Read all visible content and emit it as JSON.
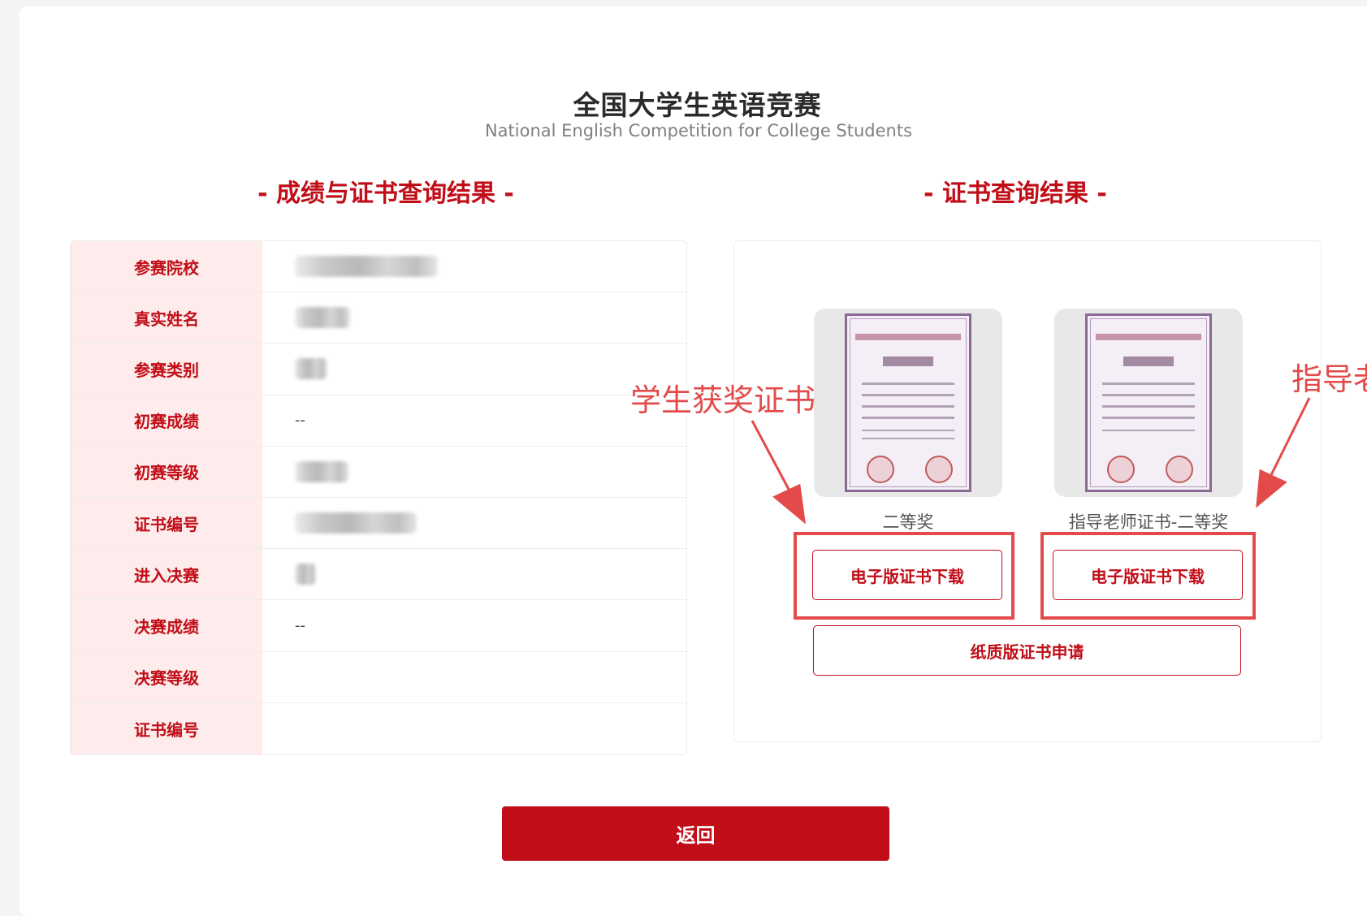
{
  "header": {
    "title": "全国大学生英语竞赛",
    "subtitle": "National English Competition for College Students"
  },
  "sections": {
    "left_title": "- 成绩与证书查询结果 -",
    "right_title": "- 证书查询结果 -"
  },
  "score_table": {
    "rows": [
      {
        "label": "参赛院校",
        "value": ""
      },
      {
        "label": "真实姓名",
        "value": ""
      },
      {
        "label": "参赛类别",
        "value": ""
      },
      {
        "label": "初赛成绩",
        "value": "--"
      },
      {
        "label": "初赛等级",
        "value": ""
      },
      {
        "label": "证书编号",
        "value": ""
      },
      {
        "label": "进入决赛",
        "value": ""
      },
      {
        "label": "决赛成绩",
        "value": "--"
      },
      {
        "label": "决赛等级",
        "value": ""
      },
      {
        "label": "证书编号",
        "value": ""
      }
    ]
  },
  "certificates": {
    "items": [
      {
        "award": "二等奖",
        "download_label": "电子版证书下载"
      },
      {
        "award": "指导老师证书-二等奖",
        "download_label": "电子版证书下载"
      }
    ],
    "paper_label": "纸质版证书申请"
  },
  "annotations": {
    "student": "学生获奖证书",
    "teacher": "指导老"
  },
  "footer": {
    "back_label": "返回"
  },
  "colors": {
    "brand_red": "#c10d17",
    "highlight_red": "#e34b4b",
    "label_bg": "#fdeceb"
  }
}
